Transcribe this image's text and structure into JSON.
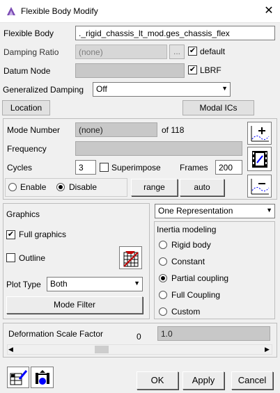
{
  "window": {
    "title": "Flexible Body Modify",
    "close_icon": "close-icon"
  },
  "flexible_body": {
    "label": "Flexible Body",
    "value": "._rigid_chassis_lt_mod.ges_chassis_flex"
  },
  "damping_ratio": {
    "label": "Damping Ratio",
    "value": "(none)",
    "browse": "...",
    "default_label": "default",
    "default_checked": true
  },
  "datum_node": {
    "label": "Datum Node",
    "value": "",
    "lbrf_label": "LBRF",
    "lbrf_checked": true
  },
  "generalized_damping": {
    "label": "Generalized Damping",
    "value": "Off"
  },
  "buttons": {
    "location": "Location",
    "modal_ics": "Modal ICs",
    "range": "range",
    "auto": "auto",
    "mode_filter": "Mode Filter",
    "ok": "OK",
    "apply": "Apply",
    "cancel": "Cancel"
  },
  "mode": {
    "number_label": "Mode Number",
    "number_value": "(none)",
    "of_total": "of 118",
    "frequency_label": "Frequency",
    "frequency_value": "",
    "cycles_label": "Cycles",
    "cycles_value": "3",
    "superimpose_label": "Superimpose",
    "superimpose_checked": false,
    "frames_label": "Frames",
    "frames_value": "200",
    "enable_label": "Enable",
    "disable_label": "Disable",
    "selected": "Disable"
  },
  "graphics": {
    "title": "Graphics",
    "full_graphics_label": "Full graphics",
    "full_graphics_checked": true,
    "outline_label": "Outline",
    "outline_checked": false,
    "plot_type_label": "Plot Type",
    "plot_type_value": "Both"
  },
  "representation": {
    "value": "One Representation",
    "inertia_title": "Inertia modeling",
    "options": [
      "Rigid body",
      "Constant",
      "Partial coupling",
      "Full Coupling",
      "Custom"
    ],
    "selected": "Partial coupling"
  },
  "deformation": {
    "label": "Deformation Scale Factor",
    "min_value": "0",
    "value": "1.0"
  },
  "colors": {
    "disabled_field": "#d7d7d7",
    "panel": "#f0f0f0",
    "accent": "#0000ff"
  }
}
